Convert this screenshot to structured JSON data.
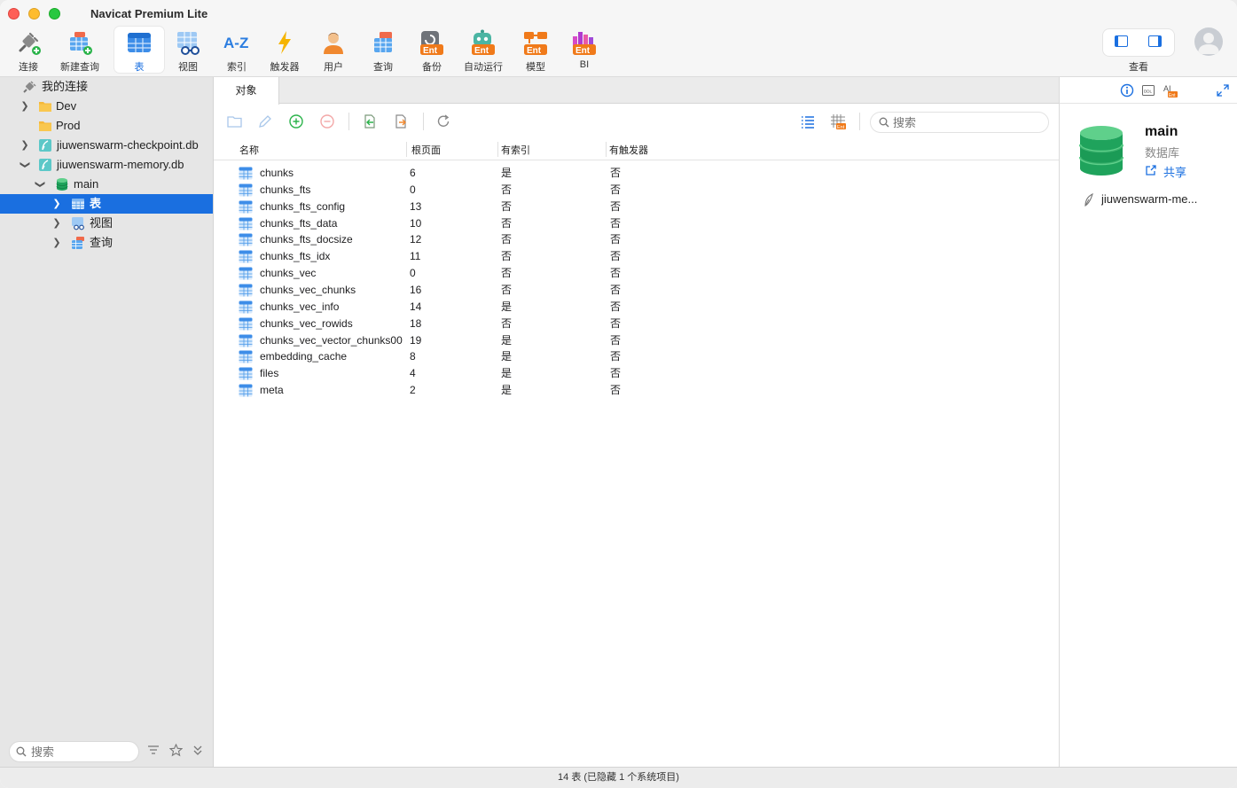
{
  "app": {
    "title": "Navicat Premium Lite"
  },
  "toolbar": {
    "items": [
      {
        "label": "连接",
        "icon": "plug-add-icon"
      },
      {
        "label": "新建查询",
        "icon": "new-query-icon"
      },
      {
        "label": "表",
        "icon": "table-icon",
        "active": true
      },
      {
        "label": "视图",
        "icon": "view-glasses-icon"
      },
      {
        "label": "索引",
        "icon": "az-index-icon"
      },
      {
        "label": "触发器",
        "icon": "lightning-trigger-icon"
      },
      {
        "label": "用户",
        "icon": "user-icon"
      },
      {
        "label": "查询",
        "icon": "query-icon"
      },
      {
        "label": "备份",
        "icon": "backup-ent-icon",
        "badge": "Ent"
      },
      {
        "label": "自动运行",
        "icon": "robot-ent-icon",
        "badge": "Ent"
      },
      {
        "label": "模型",
        "icon": "model-ent-icon",
        "badge": "Ent"
      },
      {
        "label": "BI",
        "icon": "bi-ent-icon",
        "badge": "Ent"
      }
    ],
    "view_label": "查看"
  },
  "sidebar": {
    "root": "我的连接",
    "items": [
      {
        "label": "Dev",
        "type": "folder"
      },
      {
        "label": "Prod",
        "type": "folder"
      },
      {
        "label": "jiuwenswarm-checkpoint.db",
        "type": "sqlite"
      },
      {
        "label": "jiuwenswarm-memory.db",
        "type": "sqlite"
      },
      {
        "label": "main",
        "type": "database"
      },
      {
        "label": "表",
        "type": "tables",
        "selected": true
      },
      {
        "label": "视图",
        "type": "views"
      },
      {
        "label": "查询",
        "type": "queries"
      }
    ],
    "search_placeholder": "搜索"
  },
  "main": {
    "tab": "对象",
    "search_placeholder": "搜索",
    "columns": [
      "名称",
      "根页面",
      "有索引",
      "有触发器"
    ],
    "rows": [
      [
        "chunks",
        "6",
        "是",
        "否"
      ],
      [
        "chunks_fts",
        "0",
        "否",
        "否"
      ],
      [
        "chunks_fts_config",
        "13",
        "否",
        "否"
      ],
      [
        "chunks_fts_data",
        "10",
        "否",
        "否"
      ],
      [
        "chunks_fts_docsize",
        "12",
        "否",
        "否"
      ],
      [
        "chunks_fts_idx",
        "11",
        "否",
        "否"
      ],
      [
        "chunks_vec",
        "0",
        "否",
        "否"
      ],
      [
        "chunks_vec_chunks",
        "16",
        "否",
        "否"
      ],
      [
        "chunks_vec_info",
        "14",
        "是",
        "否"
      ],
      [
        "chunks_vec_rowids",
        "18",
        "否",
        "否"
      ],
      [
        "chunks_vec_vector_chunks00",
        "19",
        "是",
        "否"
      ],
      [
        "embedding_cache",
        "8",
        "是",
        "否"
      ],
      [
        "files",
        "4",
        "是",
        "否"
      ],
      [
        "meta",
        "2",
        "是",
        "否"
      ]
    ]
  },
  "right_panel": {
    "name": "main",
    "type": "数据库",
    "share": "共享",
    "connection": "jiuwenswarm-me..."
  },
  "status": {
    "text": "14 表 (已隐藏 1 个系统项目)"
  },
  "colors": {
    "accent": "#1a6fe0",
    "selected_row": "#1a6fe0",
    "db_green": "#1fa35c"
  }
}
